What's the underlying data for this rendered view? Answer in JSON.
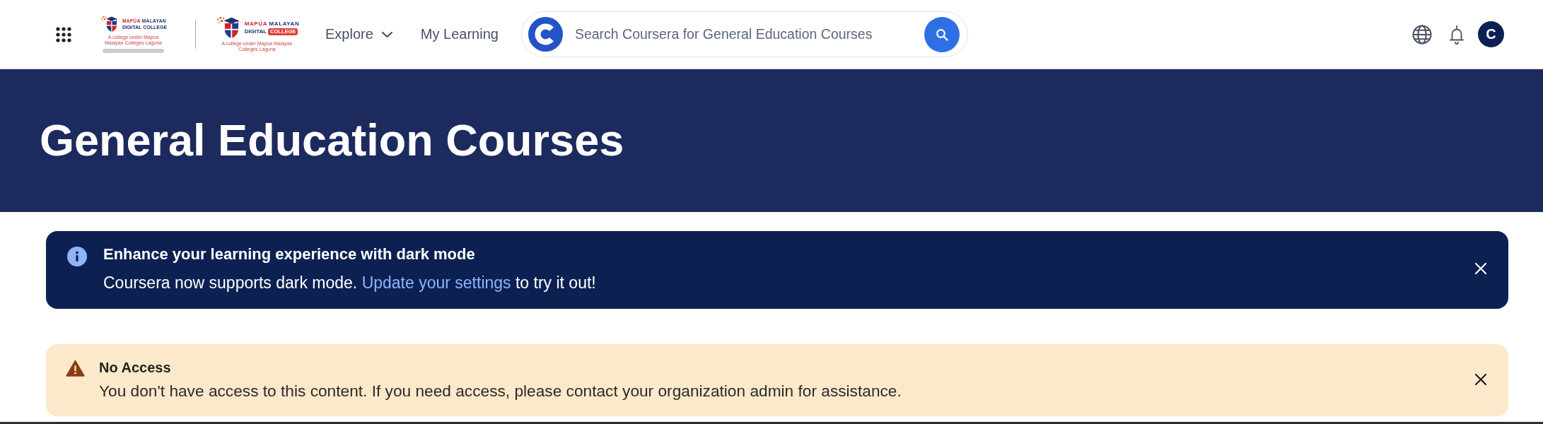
{
  "header": {
    "logos": [
      {
        "kind": "ribbon",
        "top_line": [
          "MAPÚA",
          "MALAYAN"
        ],
        "name": "DIGITAL COLLEGE",
        "tagline": "A college under Mapúa Malayan Colleges Laguna"
      },
      {
        "kind": "badge",
        "top_line": [
          "MAPÚA",
          "MALAYAN"
        ],
        "name": "DIGITAL",
        "badge": "COLLEGE",
        "tagline": "A college under Mapúa Malayan Colleges Laguna"
      }
    ],
    "nav": [
      {
        "label": "Explore",
        "kind": "dropdown"
      },
      {
        "label": "My Learning",
        "kind": "link"
      }
    ],
    "search": {
      "placeholder": "Search Coursera for General Education Courses"
    },
    "avatar": {
      "initial": "C"
    }
  },
  "hero": {
    "title": "General Education Courses"
  },
  "banners": [
    {
      "kind": "info",
      "title": "Enhance your learning experience with dark mode",
      "message": "Coursera now supports dark mode.",
      "link": "Update your settings",
      "message_end": "to try it out!"
    },
    {
      "kind": "warning",
      "title": "No Access",
      "message": "You don't have access to this content. If you need access, please contact your organization admin for assistance."
    }
  ]
}
